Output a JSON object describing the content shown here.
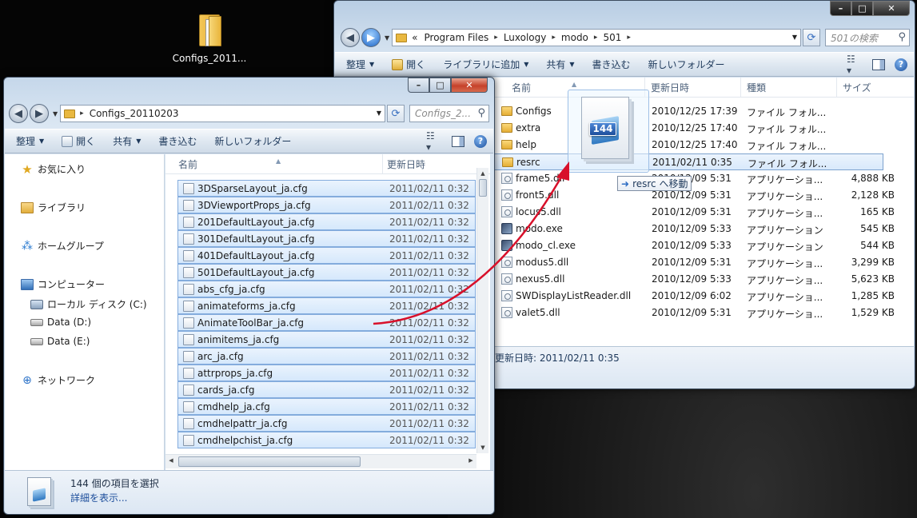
{
  "desktop": {
    "icon_label": "Configs_2011..."
  },
  "back_window": {
    "address": [
      "«",
      "Program Files",
      "Luxology",
      "modo",
      "501"
    ],
    "search_placeholder": "501の検索",
    "toolbar": {
      "organize": "整理",
      "open": "開く",
      "add_to_library": "ライブラリに追加",
      "share": "共有",
      "burn": "書き込む",
      "new_folder": "新しいフォルダー"
    },
    "columns": {
      "name": "名前",
      "date": "更新日時",
      "type": "種類",
      "size": "サイズ"
    },
    "files": [
      {
        "name": "Configs",
        "date": "2010/12/25 17:39",
        "type": "ファイル フォル...",
        "size": "",
        "icon": "folder-icon"
      },
      {
        "name": "extra",
        "date": "2010/12/25 17:40",
        "type": "ファイル フォル...",
        "size": "",
        "icon": "folder-icon"
      },
      {
        "name": "help",
        "date": "2010/12/25 17:40",
        "type": "ファイル フォル...",
        "size": "",
        "icon": "folder-icon"
      },
      {
        "name": "resrc",
        "date": "2011/02/11 0:35",
        "type": "ファイル フォル...",
        "size": "",
        "icon": "folder-icon"
      },
      {
        "name": "frame5.dll",
        "date": "2010/12/09 5:31",
        "type": "アプリケーショ...",
        "size": "4,888 KB",
        "icon": "dll-icon"
      },
      {
        "name": "front5.dll",
        "date": "2010/12/09 5:31",
        "type": "アプリケーショ...",
        "size": "2,128 KB",
        "icon": "dll-icon"
      },
      {
        "name": "locus5.dll",
        "date": "2010/12/09 5:31",
        "type": "アプリケーショ...",
        "size": "165 KB",
        "icon": "dll-icon"
      },
      {
        "name": "modo.exe",
        "date": "2010/12/09 5:33",
        "type": "アプリケーション",
        "size": "545 KB",
        "icon": "exe-icon"
      },
      {
        "name": "modo_cl.exe",
        "date": "2010/12/09 5:33",
        "type": "アプリケーション",
        "size": "544 KB",
        "icon": "exe-icon"
      },
      {
        "name": "modus5.dll",
        "date": "2010/12/09 5:31",
        "type": "アプリケーショ...",
        "size": "3,299 KB",
        "icon": "dll-icon"
      },
      {
        "name": "nexus5.dll",
        "date": "2010/12/09 5:33",
        "type": "アプリケーショ...",
        "size": "5,623 KB",
        "icon": "dll-icon"
      },
      {
        "name": "SWDisplayListReader.dll",
        "date": "2010/12/09 6:02",
        "type": "アプリケーショ...",
        "size": "1,285 KB",
        "icon": "dll-icon"
      },
      {
        "name": "valet5.dll",
        "date": "2010/12/09 5:31",
        "type": "アプリケーショ...",
        "size": "1,529 KB",
        "icon": "dll-icon"
      }
    ],
    "details_text": "更新日時: 2011/02/11 0:35"
  },
  "front_window": {
    "address": [
      "Configs_20110203"
    ],
    "search_placeholder": "Configs_2...",
    "toolbar": {
      "organize": "整理",
      "open": "開く",
      "share": "共有",
      "burn": "書き込む",
      "new_folder": "新しいフォルダー"
    },
    "nav": {
      "favorites": "お気に入り",
      "libraries": "ライブラリ",
      "homegroup": "ホームグループ",
      "computer": "コンピューター",
      "local_disk": "ローカル ディスク (C:)",
      "data_d": "Data (D:)",
      "data_e": "Data (E:)",
      "network": "ネットワーク"
    },
    "columns": {
      "name": "名前",
      "date": "更新日時"
    },
    "files": [
      {
        "name": "3DSparseLayout_ja.cfg",
        "date": "2011/02/11 0:32"
      },
      {
        "name": "3DViewportProps_ja.cfg",
        "date": "2011/02/11 0:32"
      },
      {
        "name": "201DefaultLayout_ja.cfg",
        "date": "2011/02/11 0:32"
      },
      {
        "name": "301DefaultLayout_ja.cfg",
        "date": "2011/02/11 0:32"
      },
      {
        "name": "401DefaultLayout_ja.cfg",
        "date": "2011/02/11 0:32"
      },
      {
        "name": "501DefaultLayout_ja.cfg",
        "date": "2011/02/11 0:32"
      },
      {
        "name": "abs_cfg_ja.cfg",
        "date": "2011/02/11 0:32"
      },
      {
        "name": "animateforms_ja.cfg",
        "date": "2011/02/11 0:32"
      },
      {
        "name": "AnimateToolBar_ja.cfg",
        "date": "2011/02/11 0:32"
      },
      {
        "name": "animitems_ja.cfg",
        "date": "2011/02/11 0:32"
      },
      {
        "name": "arc_ja.cfg",
        "date": "2011/02/11 0:32"
      },
      {
        "name": "attrprops_ja.cfg",
        "date": "2011/02/11 0:32"
      },
      {
        "name": "cards_ja.cfg",
        "date": "2011/02/11 0:32"
      },
      {
        "name": "cmdhelp_ja.cfg",
        "date": "2011/02/11 0:32"
      },
      {
        "name": "cmdhelpattr_ja.cfg",
        "date": "2011/02/11 0:32"
      },
      {
        "name": "cmdhelpchist_ja.cfg",
        "date": "2011/02/11 0:32"
      }
    ],
    "status": {
      "count": "144 個の項目を選択",
      "details_link": "詳細を表示..."
    }
  },
  "drag": {
    "count": "144",
    "tooltip": "resrc へ移動",
    "tooltip_icon": "arrow-right-icon"
  },
  "colors": {
    "selection_fill": "#d5e8fc",
    "selection_border": "#84acdd",
    "drag_arrow": "#d8102a",
    "link": "#1e395b"
  }
}
